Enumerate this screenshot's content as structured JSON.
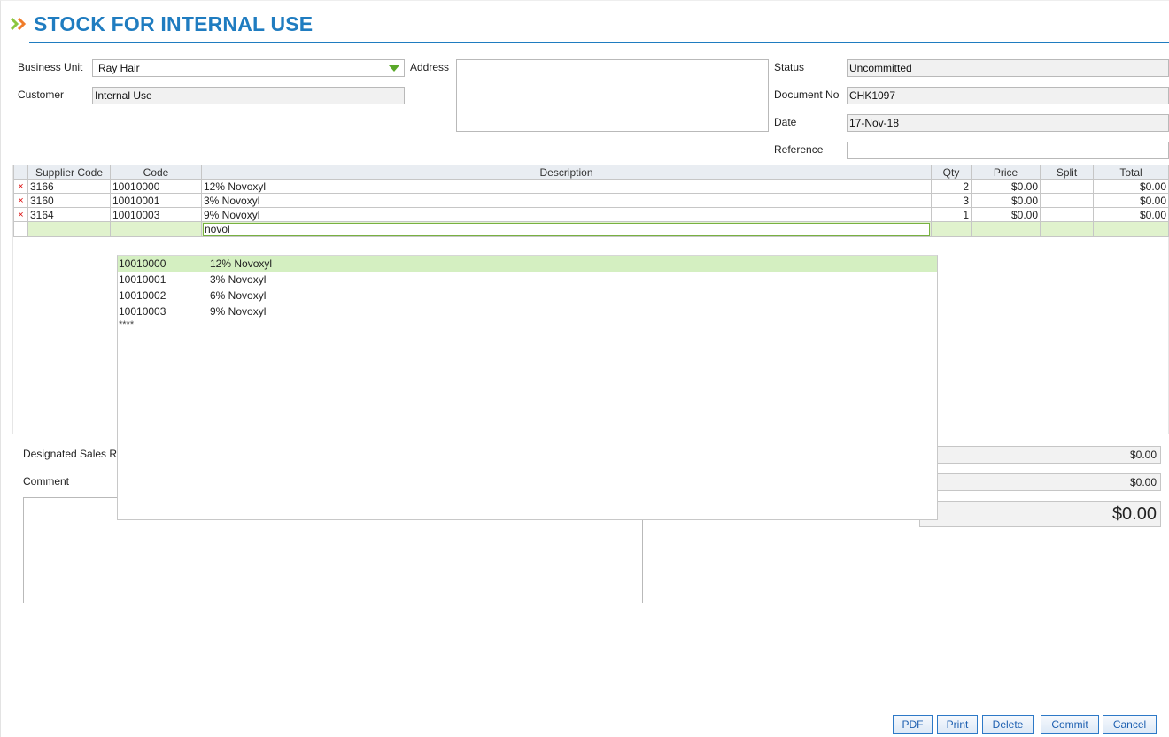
{
  "page": {
    "title": "STOCK FOR INTERNAL USE"
  },
  "header": {
    "business_unit_label": "Business Unit",
    "business_unit_value": "Ray Hair",
    "customer_label": "Customer",
    "customer_value": "Internal Use",
    "address_label": "Address",
    "status_label": "Status",
    "status_value": "Uncommitted",
    "document_no_label": "Document No",
    "document_no_value": "CHK1097",
    "date_label": "Date",
    "date_value": "17-Nov-18",
    "reference_label": "Reference",
    "reference_value": ""
  },
  "grid": {
    "columns": [
      "Supplier Code",
      "Code",
      "Description",
      "Qty",
      "Price",
      "Split",
      "Total"
    ],
    "delete_icon": "×",
    "rows": [
      {
        "supplier_code": "3166",
        "code": "10010000",
        "description": "12% Novoxyl",
        "qty": "2",
        "price": "$0.00",
        "split": "",
        "total": "$0.00"
      },
      {
        "supplier_code": "3160",
        "code": "10010001",
        "description": "3% Novoxyl",
        "qty": "3",
        "price": "$0.00",
        "split": "",
        "total": "$0.00"
      },
      {
        "supplier_code": "3164",
        "code": "10010003",
        "description": "9% Novoxyl",
        "qty": "1",
        "price": "$0.00",
        "split": "",
        "total": "$0.00"
      }
    ],
    "new_row_description": "novol"
  },
  "autocomplete": {
    "items": [
      {
        "code": "10010000",
        "description": "12% Novoxyl"
      },
      {
        "code": "10010001",
        "description": "3% Novoxyl"
      },
      {
        "code": "10010002",
        "description": "6% Novoxyl"
      },
      {
        "code": "10010003",
        "description": "9% Novoxyl"
      }
    ],
    "more": "****"
  },
  "footer": {
    "designated_sales_label": "Designated Sales R",
    "comment_label": "Comment",
    "subtotal_1": "$0.00",
    "subtotal_2": "$0.00",
    "grand_total": "$0.00"
  },
  "buttons": {
    "pdf": "PDF",
    "print": "Print",
    "delete": "Delete",
    "commit": "Commit",
    "cancel": "Cancel"
  },
  "colors": {
    "title_blue": "#1f7cc0",
    "accent_green": "#5aa829",
    "selected_row": "#d4efc1",
    "delete_red": "#dd1111"
  }
}
